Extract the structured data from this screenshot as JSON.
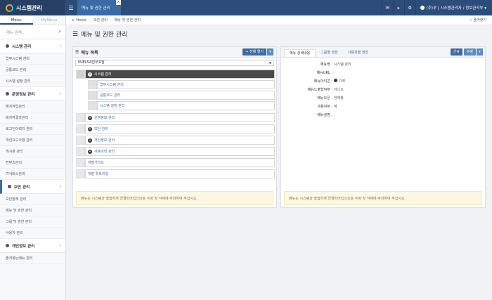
{
  "app": {
    "title": "시스템관리"
  },
  "header": {
    "active_tab": "메뉴 및 권한 관리",
    "tab_close": "×",
    "icons": [
      "✉",
      "▸",
      "⚙"
    ],
    "user_label": "(주)부 | 시스템관리자 / 정보관리부 ▾"
  },
  "sidebar": {
    "tabs": [
      "Menu",
      "MyMenu"
    ],
    "search_placeholder": "메뉴 검색...",
    "groups": [
      {
        "label": "시스템 관리",
        "chevron": "‹",
        "items": [
          "업무시스템 관리",
          "공통코드 관리",
          "시스템 설정 관리"
        ]
      },
      {
        "label": "운영정보 관리",
        "chevron": "‹",
        "items": [
          "배치작업관리",
          "배치작결과관리",
          "로그인이력지 관리",
          "개선요구사항 관리",
          "게시판 관리",
          "컨텐츠관리",
          "IT서비스관리"
        ]
      },
      {
        "label": "보안 관리",
        "chevron": "‹",
        "items": [
          "보안정책 관리",
          "메뉴 및 권한 관리",
          "그룹 및 권한 관리",
          "사용자 관리"
        ]
      },
      {
        "label": "개인정보 관리",
        "chevron": "‹",
        "items": [
          "즐겨찾는메뉴 관리"
        ]
      }
    ]
  },
  "breadcrumb": {
    "home": "Home",
    "parts": [
      "보안 관리",
      "메뉴 및 권한 관리"
    ],
    "right": "☆ 즐겨찾기"
  },
  "page": {
    "title": "메뉴 및 권한 관리"
  },
  "menu_panel": {
    "title": "메뉴 목록",
    "expand_button": "+ 전체 열기",
    "dropdown": "▾",
    "system_select": "KUELSA업무포탈",
    "tree": [
      {
        "label": "시스템 관리",
        "level": 0,
        "dark": true
      },
      {
        "label": "업무시스템 관리",
        "level": 1
      },
      {
        "label": "공통코드 관리",
        "level": 1
      },
      {
        "label": "시스템 설정 관리",
        "level": 1
      },
      {
        "label": "운영정보 관리",
        "level": 0
      },
      {
        "label": "보안 관리",
        "level": 0
      },
      {
        "label": "개인정보 관리",
        "level": 0
      },
      {
        "label": "사용이력 관리",
        "level": 0
      },
      {
        "label": "개발가이드",
        "level": 0
      },
      {
        "label": "개발 튜토리얼",
        "level": 0
      }
    ],
    "notice": "메뉴는 시스템과 밀접하게 연결되어있으므로 수정 및 삭제에 주의하여 주십시오."
  },
  "detail_panel": {
    "tabs": [
      "메뉴 상세내용",
      "그룹별 권한",
      "사용자별 권한"
    ],
    "new_button": "신규",
    "edit_button": "수정",
    "dropdown": "▾",
    "fields": [
      {
        "label": "메뉴명 :",
        "value": "시스템 관리"
      },
      {
        "label": "메뉴URL :",
        "value": ""
      },
      {
        "label": "메뉴아이콘 :",
        "value": "cog",
        "icon": true
      },
      {
        "label": "메뉴노출형여부 :",
        "value": "아니오"
      },
      {
        "label": "메뉴오픈 :",
        "value": "현재창"
      },
      {
        "label": "사용여부 :",
        "value": "예"
      },
      {
        "label": "메뉴설명 :",
        "value": ""
      }
    ],
    "notice": "메뉴는 시스템과 밀접하게 연결되어있으므로 수정 및 삭제에 주의하여 주십시오."
  }
}
